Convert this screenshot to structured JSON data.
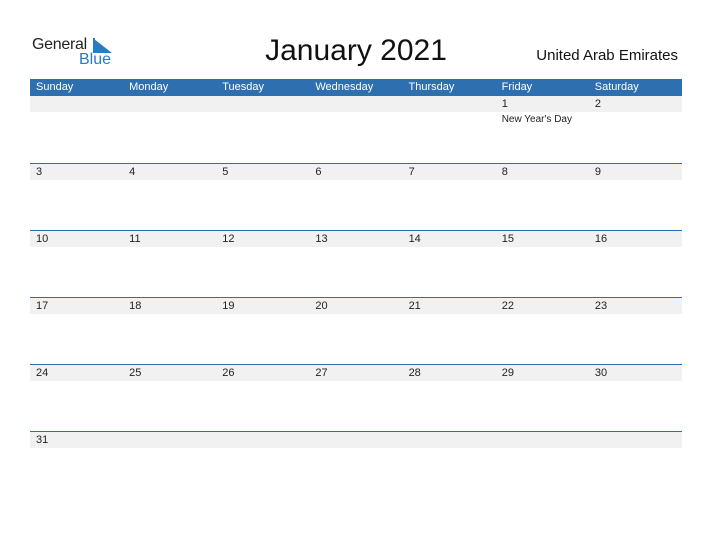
{
  "logo": {
    "text_general": "General",
    "text_blue": "Blue"
  },
  "title": "January 2021",
  "country": "United Arab Emirates",
  "weekdays": [
    "Sunday",
    "Monday",
    "Tuesday",
    "Wednesday",
    "Thursday",
    "Friday",
    "Saturday"
  ],
  "weeks": [
    [
      {
        "n": ""
      },
      {
        "n": ""
      },
      {
        "n": ""
      },
      {
        "n": ""
      },
      {
        "n": ""
      },
      {
        "n": "1",
        "event": "New Year's Day"
      },
      {
        "n": "2"
      }
    ],
    [
      {
        "n": "3"
      },
      {
        "n": "4"
      },
      {
        "n": "5"
      },
      {
        "n": "6"
      },
      {
        "n": "7"
      },
      {
        "n": "8"
      },
      {
        "n": "9"
      }
    ],
    [
      {
        "n": "10"
      },
      {
        "n": "11"
      },
      {
        "n": "12"
      },
      {
        "n": "13"
      },
      {
        "n": "14"
      },
      {
        "n": "15"
      },
      {
        "n": "16"
      }
    ],
    [
      {
        "n": "17"
      },
      {
        "n": "18"
      },
      {
        "n": "19"
      },
      {
        "n": "20"
      },
      {
        "n": "21"
      },
      {
        "n": "22"
      },
      {
        "n": "23"
      }
    ],
    [
      {
        "n": "24"
      },
      {
        "n": "25"
      },
      {
        "n": "26"
      },
      {
        "n": "27"
      },
      {
        "n": "28"
      },
      {
        "n": "29"
      },
      {
        "n": "30"
      }
    ],
    [
      {
        "n": "31"
      },
      {
        "n": ""
      },
      {
        "n": ""
      },
      {
        "n": ""
      },
      {
        "n": ""
      },
      {
        "n": ""
      },
      {
        "n": ""
      }
    ]
  ],
  "colors": {
    "accent": "#2e6fb0",
    "band": "#f1f1f1"
  }
}
